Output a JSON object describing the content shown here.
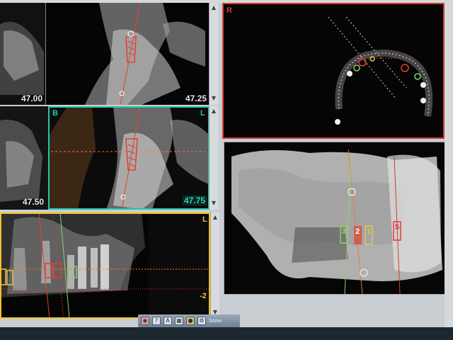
{
  "views": {
    "top_left_slice_left": "47.00",
    "top_left_slice_right": "47.25",
    "mid_left_slice_left": "47.50",
    "mid_left_slice_right": "47.75",
    "mid_left_corner_left": "B",
    "mid_left_corner_right": "L",
    "axial_corner": "R",
    "panoramic_corner": "L",
    "panoramic_scale": "-2",
    "render_labels": [
      "3",
      "2",
      "1",
      "5"
    ],
    "colors": {
      "active_border": "#27c7a6",
      "axial_border": "#d23a2e",
      "panoramic_border": "#f0c22a",
      "implant_red": "#e2412f",
      "implant_yellow": "#e6c84a",
      "implant_green": "#8fd16a",
      "guide_orange": "#f07a3a",
      "guide_dashed": "#f0c24a"
    }
  },
  "toolbar": {
    "buttons": [
      "view-tool-icon",
      "help-icon",
      "A",
      "grid-icon",
      "color-icon",
      "settings-icon"
    ],
    "label": "Some"
  }
}
